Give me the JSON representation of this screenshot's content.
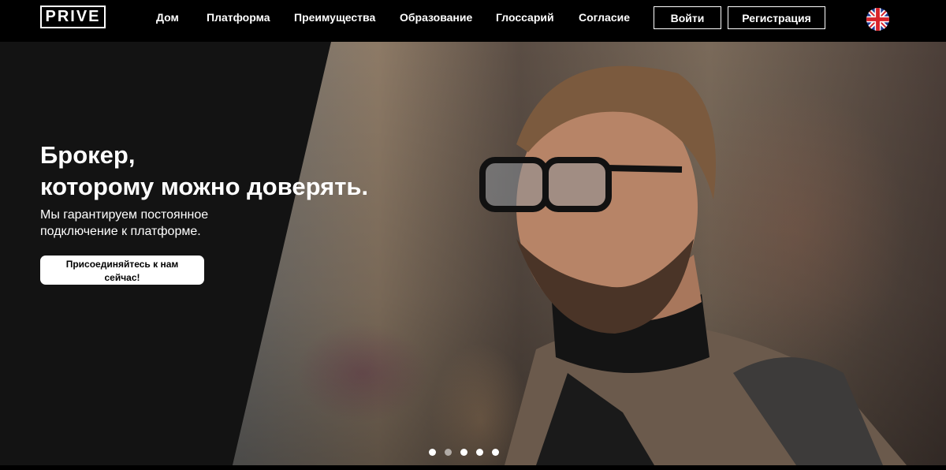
{
  "header": {
    "logo_text": "PRIVE",
    "nav": [
      {
        "label": "Дом"
      },
      {
        "label": "Платформа"
      },
      {
        "label": "Преимущества"
      },
      {
        "label": "Образование"
      },
      {
        "label": "Глоссарий"
      },
      {
        "label": "Согласие"
      }
    ],
    "login_label": "Войти",
    "register_label": "Регистрация",
    "language_icon": "uk-flag-icon"
  },
  "hero": {
    "title_line1": "Брокер,",
    "title_line2": "которому можно доверять.",
    "subtitle_line1": "Мы гарантируем постоянное",
    "subtitle_line2": "подключение к платформе.",
    "cta_line1": "Присоединяйтесь к нам",
    "cta_line2": "сейчас!",
    "slide_count": 5,
    "active_slide": 2
  },
  "colors": {
    "background": "#000000",
    "hero_panel": "#131313",
    "text": "#ffffff"
  }
}
